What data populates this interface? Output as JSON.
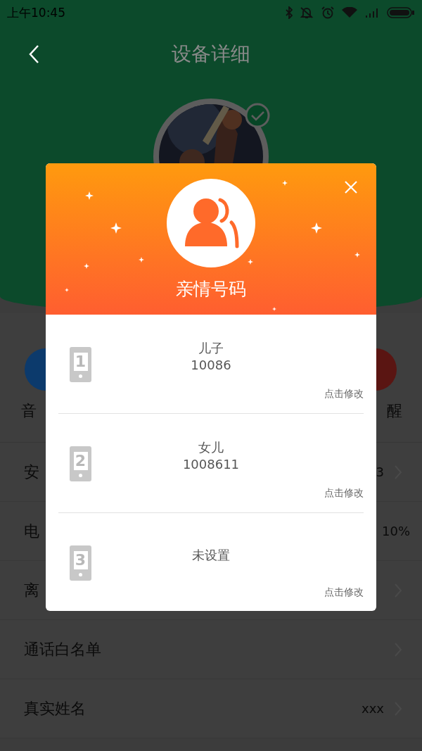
{
  "status_bar": {
    "time": "上午10:45"
  },
  "header": {
    "title": "设备详细",
    "avatar": {
      "verified": true
    }
  },
  "shortcuts": [
    {
      "label": "音",
      "color": "#0c3a6c"
    },
    {
      "label": "醒",
      "color": "#5a1512"
    }
  ],
  "settings": [
    {
      "label": "安",
      "value": "3",
      "chevron": true
    },
    {
      "label": "电",
      "value": "10%",
      "chevron": false
    },
    {
      "label": "离",
      "chevron": true
    },
    {
      "label": "通话白名单",
      "chevron": true
    },
    {
      "label": "真实姓名",
      "value": "xxx",
      "chevron": true
    }
  ],
  "dialog": {
    "title": "亲情号码",
    "contacts": [
      {
        "slot": "1",
        "name": "儿子",
        "number": "10086",
        "action": "点击修改"
      },
      {
        "slot": "2",
        "name": "女儿",
        "number": "1008611",
        "action": "点击修改"
      },
      {
        "slot": "3",
        "name": "未设置",
        "action": "点击修改"
      }
    ]
  }
}
